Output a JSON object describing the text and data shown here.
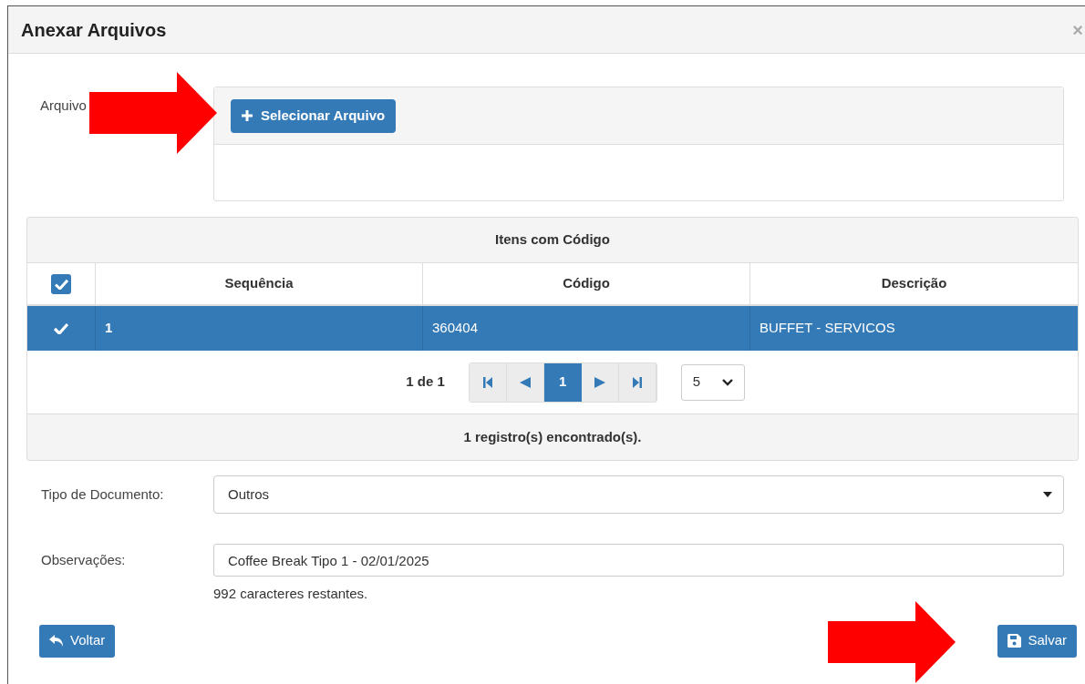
{
  "dialog": {
    "title": "Anexar Arquivos",
    "close": "×"
  },
  "file_field": {
    "label": "Arquivo",
    "button": "Selecionar Arquivo"
  },
  "table": {
    "title": "Itens com Código",
    "select_all_checked": true,
    "columns": [
      "Sequência",
      "Código",
      "Descrição"
    ],
    "rows": [
      {
        "selected": true,
        "cells": [
          "1",
          "360404",
          "BUFFET - SERVICOS"
        ]
      }
    ],
    "pagination": {
      "summary": "1 de 1",
      "buttons": [
        {
          "kind": "first"
        },
        {
          "kind": "prev"
        },
        {
          "kind": "page",
          "label": "1",
          "selected": true
        },
        {
          "kind": "next"
        },
        {
          "kind": "last"
        }
      ],
      "page_size": "5"
    },
    "footer": "1 registro(s) encontrado(s)."
  },
  "document_type": {
    "label": "Tipo de Documento:",
    "value": "Outros"
  },
  "notes": {
    "label": "Observações:",
    "value": "Coffee Break Tipo 1 - 02/01/2025",
    "counter": "992 caracteres restantes."
  },
  "buttons": [
    {
      "kind": "back",
      "label": "Voltar"
    },
    {
      "kind": "save",
      "label": "Salvar"
    }
  ],
  "annotations": [
    {
      "kind": "arrow"
    },
    {
      "kind": "arrow"
    }
  ]
}
